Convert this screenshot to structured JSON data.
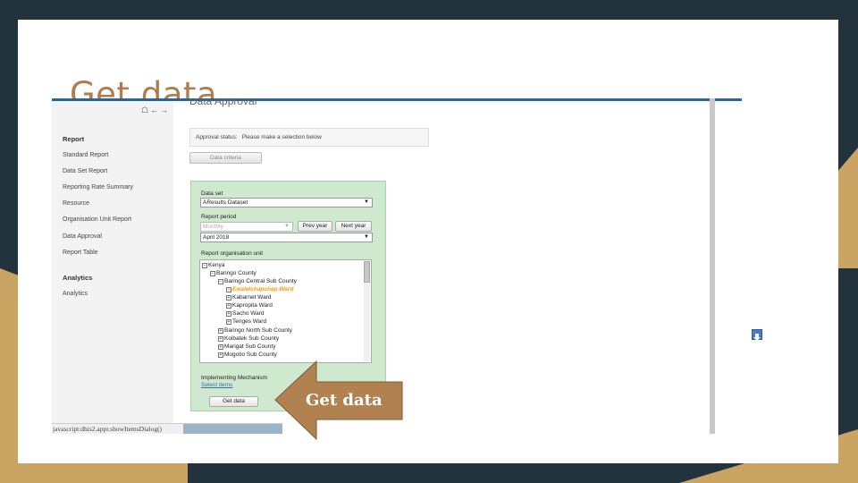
{
  "slide": {
    "title": "Get data",
    "colors": {
      "background": "#22333e",
      "accent_tan": "#c9a463",
      "title": "#b07c4e",
      "arrow_fill": "#b1824f"
    }
  },
  "app": {
    "page_heading": "Data Approval",
    "nav_icons": [
      "home-icon",
      "back-arrow-icon",
      "forward-arrow-icon"
    ],
    "sidebar": {
      "report_heading": "Report",
      "report_items": [
        "Standard Report",
        "Data Set Report",
        "Reporting Rate Summary",
        "Resource",
        "Organisation Unit Report",
        "Data Approval",
        "Report Table"
      ],
      "analytics_heading": "Analytics",
      "analytics_items": [
        "Analytics"
      ]
    },
    "approval": {
      "label": "Approval status:",
      "message": "Please make a selection below"
    },
    "criteria_button": "Data criteria",
    "form": {
      "data_set_label": "Data set",
      "data_set_value": "AResults Dataset",
      "period_label": "Report period",
      "period_type": "Monthly",
      "prev_year": "Prev year",
      "next_year": "Next year",
      "period_value": "April 2018",
      "org_unit_label": "Report organisation unit",
      "mechanism_label": "Implementing Mechanism",
      "select_items": "Select items",
      "get_data": "Get data"
    },
    "org_tree": [
      {
        "label": "Kenya",
        "level": 0,
        "sign": "−"
      },
      {
        "label": "Baringo County",
        "level": 1,
        "sign": "−"
      },
      {
        "label": "Baringo Central Sub County",
        "level": 2,
        "sign": "−"
      },
      {
        "label": "Ewalelchapchap Ward",
        "level": 3,
        "sign": "+",
        "selected": true
      },
      {
        "label": "Kabarnet Ward",
        "level": 3,
        "sign": "+"
      },
      {
        "label": "Kapropita Ward",
        "level": 3,
        "sign": "+"
      },
      {
        "label": "Sacho Ward",
        "level": 3,
        "sign": "+"
      },
      {
        "label": "Tenges Ward",
        "level": 3,
        "sign": "+"
      },
      {
        "label": "Baringo North Sub County",
        "level": 2,
        "sign": "+"
      },
      {
        "label": "Koibatek Sub County",
        "level": 2,
        "sign": "+"
      },
      {
        "label": "Marigat Sub County",
        "level": 2,
        "sign": "+"
      },
      {
        "label": "Mogotio Sub County",
        "level": 2,
        "sign": "+"
      }
    ],
    "status_bar_text": "javascript:dhis2.appr.showItemsDialog()"
  },
  "callout": {
    "text": "Get data"
  }
}
